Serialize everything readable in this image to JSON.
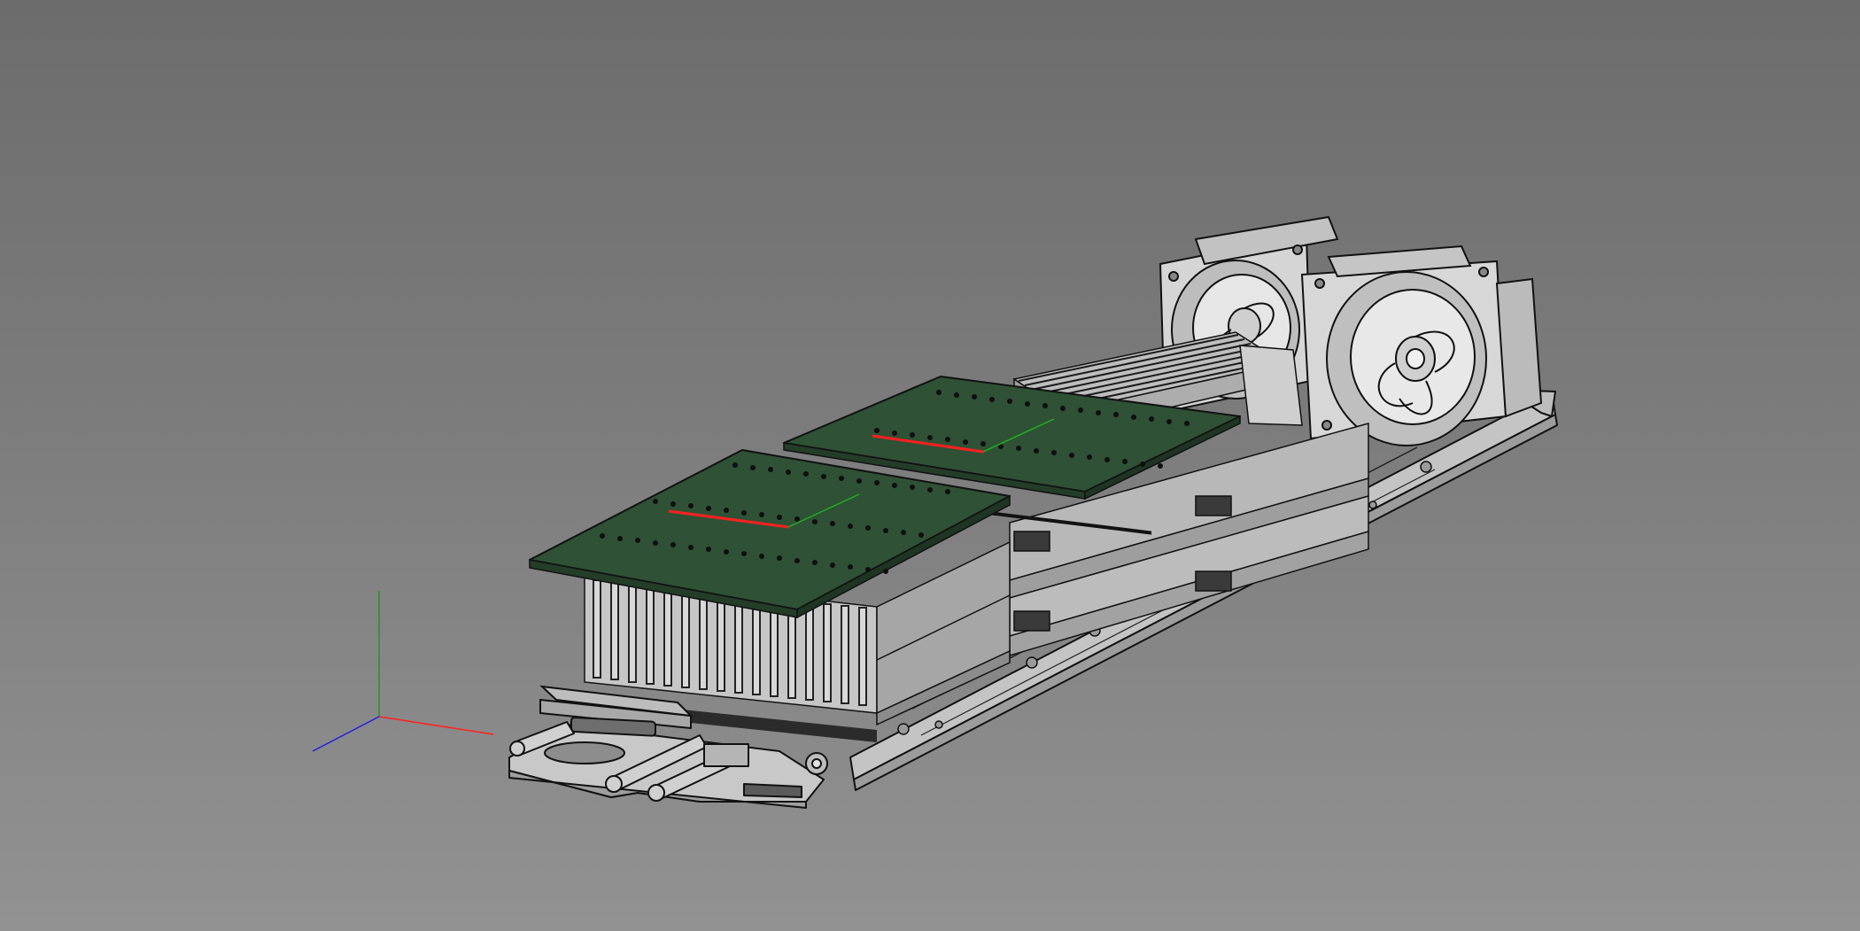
{
  "viewport": {
    "background_top": "#6c6c6c",
    "background_bottom": "#929292",
    "render_mode": "shaded-with-edges"
  },
  "colors": {
    "pcb_green": "#2f5136",
    "pcb_green_dark": "#233d29",
    "metal_light": "#c9c9c9",
    "metal_mid": "#a9a9a9",
    "metal_dark": "#8d8d8d",
    "edge": "#111111",
    "x_axis": "#ff2020",
    "y_axis": "#1a9a1a",
    "z_axis": "#2020e0"
  },
  "model": {
    "parts": [
      {
        "name": "chassis-tray"
      },
      {
        "name": "memory-riser-board-front"
      },
      {
        "name": "memory-riser-board-rear"
      },
      {
        "name": "dimm-module-stack"
      },
      {
        "name": "cpu-heatsink"
      },
      {
        "name": "cooling-fan-left"
      },
      {
        "name": "cooling-fan-right"
      },
      {
        "name": "front-bracket-with-handles"
      },
      {
        "name": "front-label-plate"
      }
    ]
  },
  "axis_triad": {
    "x": "x-axis",
    "y": "y-axis",
    "z": "z-axis"
  }
}
